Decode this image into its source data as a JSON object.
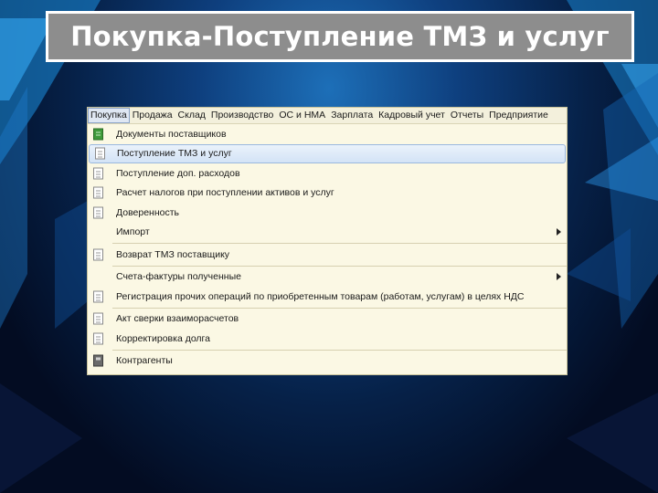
{
  "slide": {
    "title": "Покупка-Поступление ТМЗ и услуг"
  },
  "menubar": {
    "items": [
      "Покупка",
      "Продажа",
      "Склад",
      "Производство",
      "ОС и НМА",
      "Зарплата",
      "Кадровый учет",
      "Отчеты",
      "Предприятие"
    ],
    "active_index": 0
  },
  "dropdown": {
    "items": [
      {
        "label": "Документы поставщиков",
        "icon": "journal-icon"
      },
      {
        "label": "Поступление ТМЗ и услуг",
        "icon": "document-icon",
        "selected": true
      },
      {
        "label": "Поступление доп. расходов",
        "icon": "document-icon"
      },
      {
        "label": "Расчет налогов при поступлении активов и услуг",
        "icon": "document-icon"
      },
      {
        "label": "Доверенность",
        "icon": "document-icon"
      },
      {
        "label": "Импорт",
        "submenu": true
      },
      {
        "label": "Возврат ТМЗ поставщику",
        "icon": "document-icon"
      },
      {
        "label": "Счета-фактуры полученные",
        "submenu": true
      },
      {
        "label": "Регистрация прочих операций по приобретенным товарам (работам, услугам) в целях НДС",
        "icon": "document-icon"
      },
      {
        "label": "Акт сверки взаиморасчетов",
        "icon": "document-icon"
      },
      {
        "label": "Корректировка долга",
        "icon": "document-icon"
      },
      {
        "label": "Контрагенты",
        "icon": "catalog-icon"
      }
    ]
  },
  "colors": {
    "title_box": "#8d8d8d",
    "menu_background": "#fbf8e4",
    "selection": "#d3e3f6"
  }
}
